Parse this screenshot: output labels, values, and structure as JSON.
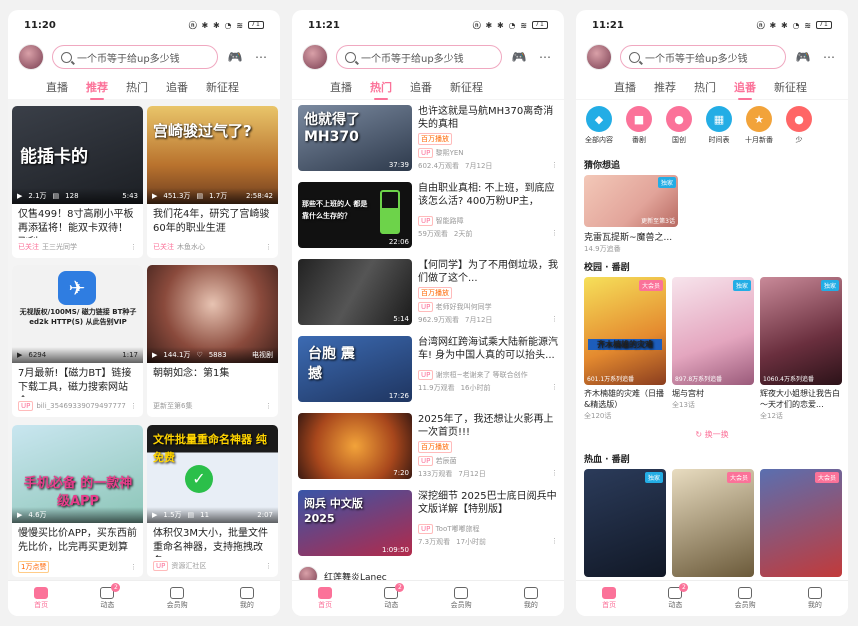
{
  "colors": {
    "accent": "#fb7299"
  },
  "phones": [
    {
      "time": "11:20",
      "search_placeholder": "一个币等于给up多少钱",
      "tabs": [
        "直播",
        "推荐",
        "热门",
        "追番",
        "新征程"
      ],
      "active_tab": 1
    },
    {
      "time": "11:21",
      "search_placeholder": "一个币等于给up多少钱",
      "tabs": [
        "直播",
        "热门",
        "追番",
        "新征程"
      ],
      "active_tab": 1
    },
    {
      "time": "11:21",
      "search_placeholder": "一个币等于给up多少钱",
      "tabs": [
        "直播",
        "推荐",
        "热门",
        "追番",
        "新征程"
      ],
      "active_tab": 3
    }
  ],
  "battery": "71",
  "nav": [
    {
      "label": "首页"
    },
    {
      "label": "动态",
      "badge": "2"
    },
    {
      "label": "会员购"
    },
    {
      "label": "我的"
    }
  ],
  "p1": {
    "cards": [
      {
        "thumb_text": "能插卡的",
        "views": "2.1万",
        "danmaku": "128",
        "duration": "5:43",
        "title": "仅售499！8寸高刷小平板再添猛将！能双卡双待！飞利...",
        "follow": "已关注",
        "up": "王三光同学"
      },
      {
        "thumb_text": "宫崎骏过气了?",
        "views": "451.3万",
        "danmaku": "1.7万",
        "duration": "2:58:42",
        "title": "我们花4年，研究了宫崎骏60年的职业生涯",
        "follow": "已关注",
        "up": "木鱼水心"
      },
      {
        "thumb_text": "无视版权/100MS/ 磁力链接 BT种子 ed2k HTTP(S) 从此告别VIP",
        "views": "6294",
        "danmaku": "",
        "duration": "1:17",
        "title": "7月最新!【磁力BT】链接下载工具，磁力搜索网站全...",
        "follow": "",
        "up": "bili_35469339079497777"
      },
      {
        "thumb_text": "",
        "views": "144.1万",
        "danmaku": "5883",
        "duration": "电视剧",
        "title": "朝朝如念：第1集",
        "follow": "",
        "up": "更新至第6集"
      },
      {
        "thumb_text": "手机必备 的一款神级APP",
        "views": "4.6万",
        "danmaku": "",
        "duration": "",
        "title": "慢慢买比价APP，买东西前先比价，比完再买更划算",
        "follow": "1万点赞",
        "up": ""
      },
      {
        "thumb_text": "文件批量重命名神器 纯免费",
        "views": "1.5万",
        "danmaku": "11",
        "duration": "2:07",
        "title": "体积仅3M大小，批量文件重命名神器，支持拖拽改名，...",
        "follow": "",
        "up": "资源汇社区"
      }
    ]
  },
  "p2": {
    "items": [
      {
        "thumb_text": "他就得了 MH370",
        "duration": "37:39",
        "title": "也许这就是马航MH370离奇消失的真相",
        "badge": "百万播放",
        "up": "黎熙YEN",
        "views": "602.4万观看",
        "date": "7月12日"
      },
      {
        "thumb_text": "那些不上班的人 都是靠什么生存的？",
        "duration": "22:06",
        "title": "自由职业真相: 不上班，到底应该怎么活? 400万粉UP主，在...",
        "badge": "",
        "up": "智能路障",
        "views": "59万观看",
        "date": "2天前"
      },
      {
        "thumb_text": "",
        "duration": "5:14",
        "title": "【何同学】为了不用倒垃圾，我们做了这个...",
        "badge": "百万播放",
        "up": "老师好我叫何同学",
        "views": "962.9万观看",
        "date": "7月12日"
      },
      {
        "thumb_text": "台胞 震撼",
        "duration": "17:26",
        "title": "台湾网红跨海试乘大陆新能源汽车! 身为中国人真的可以抬头...",
        "badge": "",
        "up": "谢宗桓~老谢来了 等联合创作",
        "views": "11.9万观看",
        "date": "16小时前"
      },
      {
        "thumb_text": "",
        "duration": "7:20",
        "title": "2025年了，我还想让火影再上一次首页!!!",
        "badge": "百万播放",
        "up": "若辰菌",
        "views": "133万观看",
        "date": "7月12日"
      },
      {
        "thumb_text": "阅兵 中文版 2025",
        "duration": "1:09:50",
        "title": "深挖细节 2025巴士底日阅兵中文版详解【特别版】",
        "badge": "",
        "up": "TooT嘟嘟旅程",
        "views": "7.3万观看",
        "date": "17小时前"
      }
    ],
    "live_name": "红莲舞炎Lanec"
  },
  "p3": {
    "cats": [
      {
        "label": "全部内容",
        "color": "#23ade5",
        "icon": "◆"
      },
      {
        "label": "番剧",
        "color": "#fb7299",
        "icon": "■"
      },
      {
        "label": "国创",
        "color": "#fb7299",
        "icon": "●"
      },
      {
        "label": "时间表",
        "color": "#23ade5",
        "icon": "▦"
      },
      {
        "label": "十月新番",
        "color": "#f2a33a",
        "icon": "★"
      },
      {
        "label": "少",
        "color": "#f66",
        "icon": "●"
      }
    ],
    "guess_title": "猜你想追",
    "guess": {
      "badge": "独家",
      "update": "更新至第3话",
      "name": "克雷瓦提斯~魔兽之...",
      "sub": "14.9万追番"
    },
    "campus_title": "校园 · 番剧",
    "campus": [
      {
        "badge": "大会员",
        "badge_color": "#fb7299",
        "thumb_text": "齐木楠雄的灾难",
        "count": "601.1万系列追番",
        "name": "齐木楠雄的灾难（日播&精选版）",
        "sub": "全120话"
      },
      {
        "badge": "独家",
        "badge_color": "#23ade5",
        "thumb_text": "",
        "count": "897.8万系列追番",
        "name": "堀与宫村",
        "sub": "全13话"
      },
      {
        "badge": "独家",
        "badge_color": "#23ade5",
        "thumb_text": "",
        "count": "1060.4万系列追番",
        "name": "辉夜大小姐想让我告白～天才们的恋爱...",
        "sub": "全12话"
      }
    ],
    "refresh": "换一换",
    "hot_title": "热血 · 番剧",
    "hot": [
      {
        "badge": "独家",
        "badge_color": "#23ade5"
      },
      {
        "badge": "大会员",
        "badge_color": "#fb7299"
      },
      {
        "badge": "大会员",
        "badge_color": "#fb7299"
      }
    ]
  }
}
